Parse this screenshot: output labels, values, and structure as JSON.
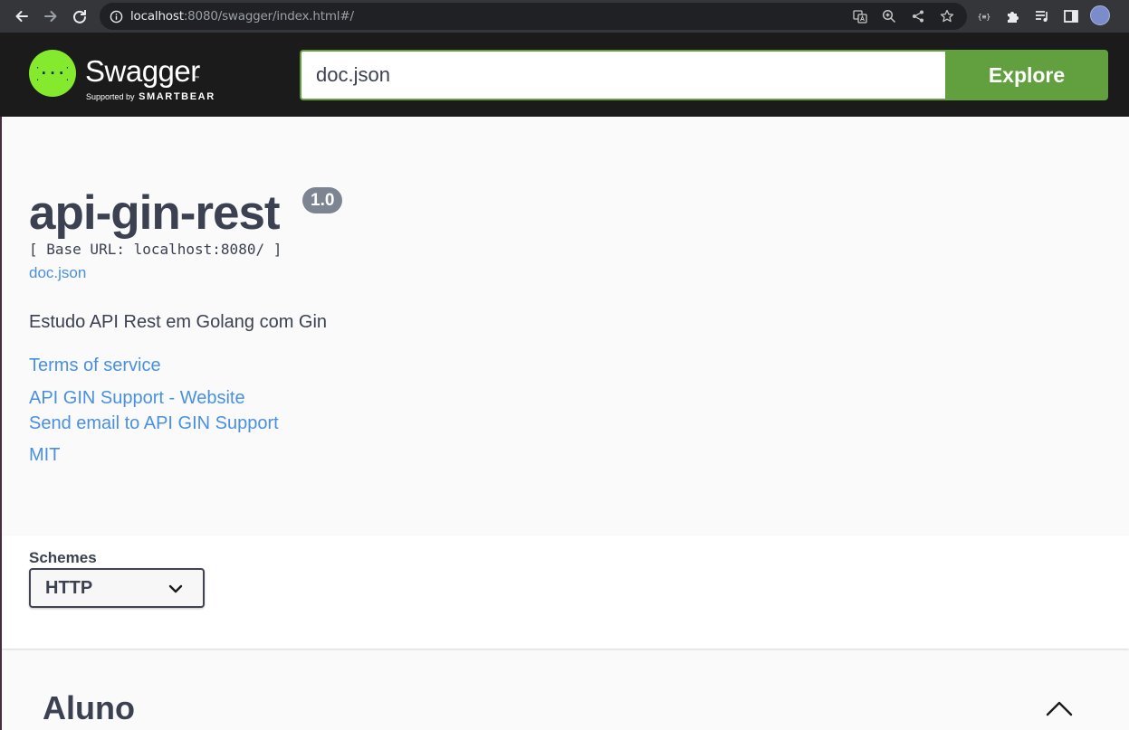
{
  "browser": {
    "url_host": "localhost",
    "url_rest": ":8080/swagger/index.html#/"
  },
  "topbar": {
    "logo_word": "Swagger",
    "logo_tm": "™",
    "logo_supported": "Supported by",
    "logo_brand": "SMARTBEAR",
    "search_value": "doc.json",
    "explore_label": "Explore"
  },
  "info": {
    "title": "api-gin-rest",
    "version": "1.0",
    "base_url": "[ Base URL: localhost:8080/ ]",
    "doc_link": "doc.json",
    "description": "Estudo API Rest em Golang com Gin",
    "terms": "Terms of service",
    "support_website": "API GIN Support - Website",
    "support_email": "Send email to API GIN Support",
    "license": "MIT"
  },
  "schemes": {
    "label": "Schemes",
    "selected": "HTTP"
  },
  "tag": {
    "title": "Aluno"
  },
  "colors": {
    "accent_green": "#62a03f",
    "logo_green": "#85ea2d",
    "link_blue": "#4990e2",
    "text_dark": "#3b4151",
    "badge_gray": "#7d8492"
  }
}
